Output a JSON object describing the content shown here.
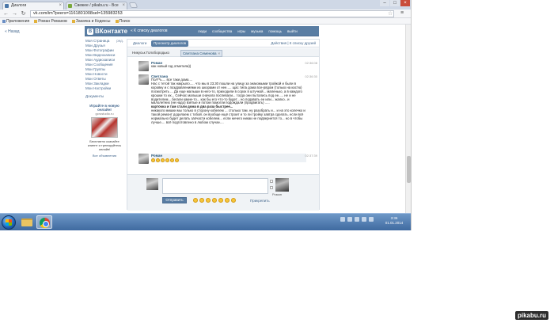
{
  "browser": {
    "tabs": [
      {
        "title": "Диалоги"
      },
      {
        "title": "Свежее / pikabu.ru - Все"
      }
    ],
    "url": "vk.com/im?peers=1161801008sel=135983253",
    "bookmarks": [
      "Приложения",
      "Роман Романов",
      "Закачка и Кодексы",
      "Поиск"
    ]
  },
  "vk": {
    "back_link": "« Назад",
    "logo": "ВКонтакте",
    "to_dialogs": "« К списку диалогов",
    "nav": [
      "люди",
      "сообщества",
      "игры",
      "музыка",
      "помощь",
      "выйти"
    ],
    "sidebar": [
      {
        "label": "Моя Страница",
        "badge": "ред."
      },
      {
        "label": "Мои Друзья"
      },
      {
        "label": "Мои Фотографии"
      },
      {
        "label": "Мои Видеозаписи"
      },
      {
        "label": "Мои Аудиозаписи"
      },
      {
        "label": "Мои Сообщения"
      },
      {
        "label": "Мои Группы"
      },
      {
        "label": "Мои Новости"
      },
      {
        "label": "Мои Ответы"
      },
      {
        "label": "Мои Закладки"
      },
      {
        "label": "Мои Настройки"
      },
      {
        "label": "Документы"
      }
    ],
    "ad": {
      "title": "Играйте в новую онлайн!",
      "sub": "gcrustudio.ru",
      "text": "Бесплатно скачайте клиент и тренируйтесь онлайн!",
      "all": "Все объявления"
    },
    "dialog_tabs": {
      "dialogs": "Диалоги",
      "view": "Просмотр диалогов",
      "right": "Действия | К списку друзей"
    },
    "members": [
      {
        "name": "Никуськ Голобородько"
      },
      {
        "name": "Светлана Семенова"
      }
    ],
    "messages": [
      {
        "author": "Роман",
        "time": "02:36:08",
        "text": "как новый год отметили))"
      },
      {
        "author": "Светлана",
        "time": "02:36:30",
        "text": "Пол**ь.... все таки дома....",
        "text2": "Нас с тетой так накрыло..... что мы в 23.30 пошли на улицу за знакомыми тройкой и были в коровку и с поздравлениями из шкорами от нее..... щас типа дома все-рядом (только на кастю) посмотреть ... Да еще малыши в него-то, приходили в сорок в штучкой... маленько, а в каждого крошки то их... Сейчас малыши сначала поспевали... тогда они пытались под ее..... не и не водителем... бегали какие-то... как бы его что-то будет... но подавать ее или... жалко.. и малолетних (не надо) взятые и потом помогли подождали (продвигать) .....",
        "text3": "карточка и там стали дома в два раза быстрее...",
        "text4": "никакого мишки мы только в сторону кобелем ... столько там. ну разобрать и... и на это колечко и такой ремонт доделаем с тобой. он вообще ещё строит и то ли тройку завтра сделать. если всё нормально будет делать запчасти кобелем... если ничего никак не подвернется то... но в чтобы лучше.... всё подготовлено в любом случае...."
      },
      {
        "author": "Роман",
        "time": "02:37:39",
        "text": ""
      }
    ],
    "composer": {
      "placeholder": "",
      "send": "Отправить",
      "attach": "Прикрепить",
      "peer": "Роман"
    }
  },
  "taskbar": {
    "time": "3:36",
    "date": "01.01.2014"
  },
  "watermark": "pikabu.ru"
}
